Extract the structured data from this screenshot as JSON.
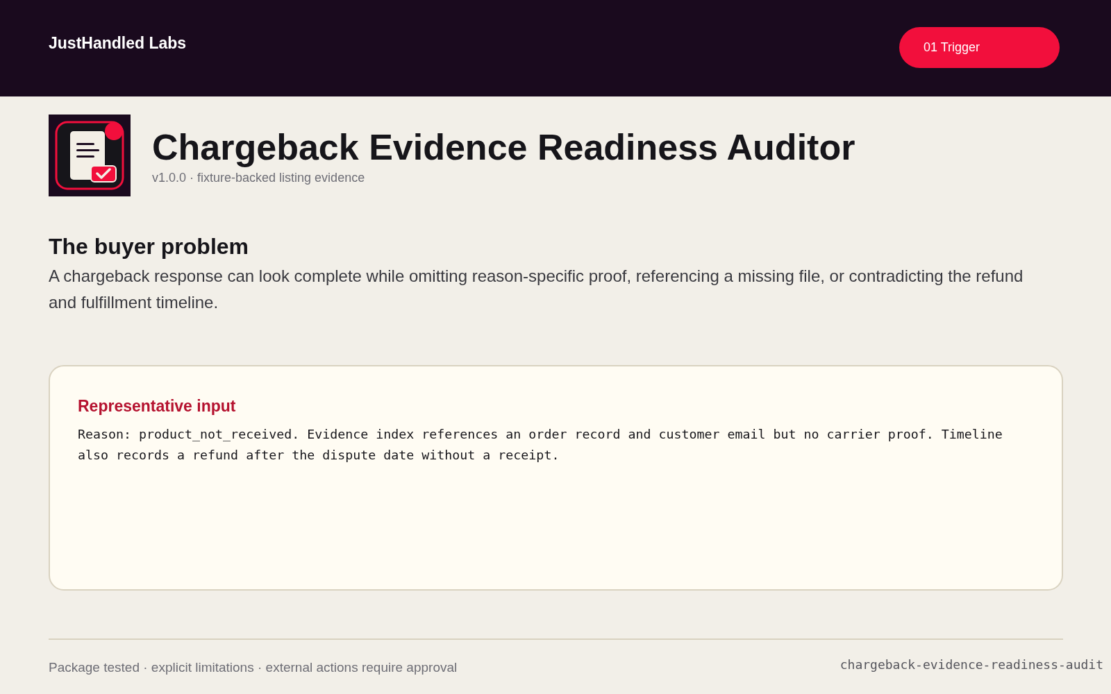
{
  "header": {
    "brand": "JustHandled Labs",
    "button": {
      "label": "01 Trigger"
    }
  },
  "hero": {
    "title": "Chargeback Evidence Readiness Auditor",
    "subtitle": "v1.0.0 · fixture-backed listing evidence"
  },
  "problem": {
    "heading": "The buyer problem",
    "text": "A chargeback response can look complete while omitting reason-specific proof, referencing a missing file, or contradicting the refund and fulfillment timeline."
  },
  "input_card": {
    "heading": "Representative input",
    "text": "Reason: product_not_received. Evidence index references an order record and customer email but no carrier proof. Timeline also records a refund after the dispute date without a receipt."
  },
  "footer": {
    "note": "Package tested · explicit limitations · external actions require approval",
    "package_name": "chargeback-evidence-readiness-audit"
  }
}
